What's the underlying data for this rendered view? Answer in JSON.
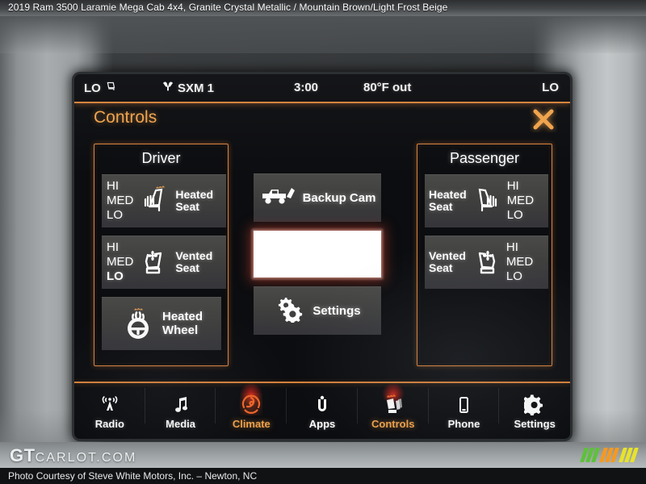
{
  "caption": {
    "text": "2019 Ram 3500 Laramie Mega Cab 4x4,  Granite Crystal Metallic / Mountain Brown/Light Frost Beige"
  },
  "colors": {
    "accent_orange": "#f0a24a",
    "panel_border": "#d9813c",
    "tile_bg": "#40403f",
    "screen_bg": "#0c0d10",
    "text_white": "#ffffff",
    "highlight_red": "#dc2319",
    "stripe_green": "#5ec13a",
    "stripe_orange": "#f5991f",
    "stripe_yellow": "#e8e22a"
  },
  "status_bar": {
    "left_temp": "LO",
    "left_icon": "driver-seat-climate-icon",
    "source_icon": "satellite-radio-icon",
    "source": "SXM 1",
    "time": "3:00",
    "outside_temp": "80°F out",
    "right_temp": "LO"
  },
  "header": {
    "title": "Controls",
    "close_icon": "close-icon"
  },
  "driver": {
    "title": "Driver",
    "tiles": [
      {
        "label": "Heated Seat",
        "label_line1": "Heated",
        "label_line2": "Seat",
        "icon": "heated-seat-icon",
        "levels": [
          "HI",
          "MED",
          "LO"
        ],
        "active_level": ""
      },
      {
        "label": "Vented Seat",
        "label_line1": "Vented",
        "label_line2": "Seat",
        "icon": "vented-seat-icon",
        "levels": [
          "HI",
          "MED",
          "LO"
        ],
        "active_level": "LO"
      },
      {
        "label": "Heated Wheel",
        "label_line1": "Heated",
        "label_line2": "Wheel",
        "icon": "heated-steering-wheel-icon",
        "levels": [],
        "active_level": ""
      }
    ]
  },
  "passenger": {
    "title": "Passenger",
    "tiles": [
      {
        "label": "Heated Seat",
        "label_line1": "Heated",
        "label_line2": "Seat",
        "icon": "heated-seat-icon",
        "levels": [
          "HI",
          "MED",
          "LO"
        ],
        "active_level": ""
      },
      {
        "label": "Vented Seat",
        "label_line1": "Vented",
        "label_line2": "Seat",
        "icon": "vented-seat-icon",
        "levels": [
          "HI",
          "MED",
          "LO"
        ],
        "active_level": ""
      }
    ]
  },
  "center": {
    "backup_cam": {
      "label": "Backup Cam",
      "icon": "pickup-truck-tailgate-icon"
    },
    "blank_tile": {
      "label": "",
      "icon": ""
    },
    "settings": {
      "label": "Settings",
      "icon": "gears-icon"
    }
  },
  "nav": {
    "items": [
      {
        "label": "Radio",
        "icon": "radio-tower-icon",
        "active": false
      },
      {
        "label": "Media",
        "icon": "music-note-icon",
        "active": false
      },
      {
        "label": "Climate",
        "icon": "climate-fan-icon",
        "active": true
      },
      {
        "label": "Apps",
        "icon": "uconnect-apps-icon",
        "active": false
      },
      {
        "label": "Controls",
        "icon": "seat-controls-icon",
        "active": true
      },
      {
        "label": "Phone",
        "icon": "phone-icon",
        "active": false
      },
      {
        "label": "Settings",
        "icon": "gear-icon",
        "active": false
      }
    ]
  },
  "watermark": {
    "logo_bold": "GT",
    "logo_rest": "CARLOT.COM",
    "credit": "Photo Courtesy of Steve White Motors, Inc. – Newton, NC"
  }
}
